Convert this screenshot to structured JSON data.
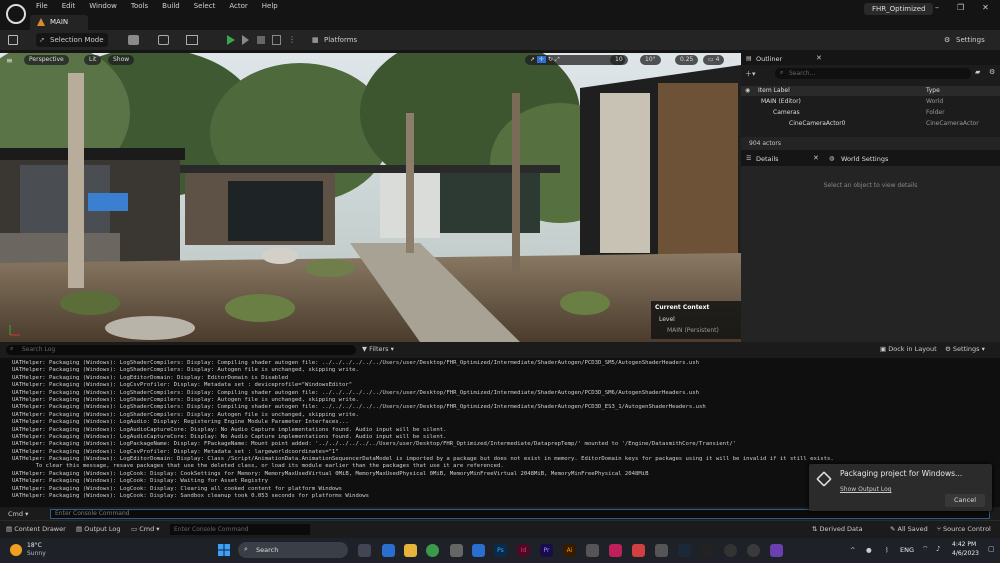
{
  "menu": [
    "File",
    "Edit",
    "Window",
    "Tools",
    "Build",
    "Select",
    "Actor",
    "Help"
  ],
  "level_tab": "MAIN",
  "project_name": "FHR_Optimized",
  "toolbar": {
    "selection_mode": "Selection Mode",
    "platforms": "Platforms",
    "settings": "Settings"
  },
  "viewport": {
    "perspective": "Perspective",
    "lit": "Lit",
    "show": "Show",
    "grid": "10",
    "angle": "10°",
    "scale": "0.25",
    "camera_speed": "4",
    "context_title": "Current Context",
    "context_level": "Level",
    "context_value": "MAIN (Persistent)"
  },
  "outliner": {
    "title": "Outliner",
    "search_placeholder": "Search...",
    "col_label": "Item Label",
    "col_type": "Type",
    "rows": [
      {
        "label": "MAIN (Editor)",
        "type": "World"
      },
      {
        "label": "Cameras",
        "type": "Folder"
      },
      {
        "label": "CineCameraActor0",
        "type": "CineCameraActor"
      }
    ],
    "actor_count": "904 actors"
  },
  "details": {
    "tab1": "Details",
    "tab2": "World Settings",
    "empty_message": "Select an object to view details"
  },
  "output_log": {
    "search_placeholder": "Search Log",
    "filters": "Filters",
    "dock": "Dock in Layout",
    "settings": "Settings",
    "lines": [
      "UATHelper: Packaging (Windows): LogShaderCompilers: Display: Compiling shader autogen file: ../../../../../../Users/user/Desktop/FHR_Optimized/Intermediate/ShaderAutogen/PCD3D_SM5/AutogenShaderHeaders.ush",
      "UATHelper: Packaging (Windows): LogShaderCompilers: Display: Autogen file is unchanged, skipping write.",
      "UATHelper: Packaging (Windows): LogEditorDomain: Display: EditorDomain is Disabled",
      "UATHelper: Packaging (Windows): LogCsvProfiler: Display: Metadata set : deviceprofile=\"WindowsEditor\"",
      "UATHelper: Packaging (Windows): LogShaderCompilers: Display: Compiling shader autogen file: ../../../../../../Users/user/Desktop/FHR_Optimized/Intermediate/ShaderAutogen/PCD3D_SM6/AutogenShaderHeaders.ush",
      "UATHelper: Packaging (Windows): LogShaderCompilers: Display: Autogen file is unchanged, skipping write.",
      "UATHelper: Packaging (Windows): LogShaderCompilers: Display: Compiling shader autogen file: ../../../../../../Users/user/Desktop/FHR_Optimized/Intermediate/ShaderAutogen/PCD3D_ES3_1/AutogenShaderHeaders.ush",
      "UATHelper: Packaging (Windows): LogShaderCompilers: Display: Autogen file is unchanged, skipping write.",
      "UATHelper: Packaging (Windows): LogAudio: Display: Registering Engine Module Parameter Interfaces...",
      "UATHelper: Packaging (Windows): LogAudioCaptureCore: Display: No Audio Capture implementations found. Audio input will be silent.",
      "UATHelper: Packaging (Windows): LogAudioCaptureCore: Display: No Audio Capture implementations found. Audio input will be silent.",
      "UATHelper: Packaging (Windows): LogPackageName: Display: FPackageName: Mount point added: '../../../../../../Users/user/Desktop/FHR_Optimized/Intermediate/DataprepTemp/' mounted to '/Engine/DatasmithCore/Transient/'",
      "UATHelper: Packaging (Windows): LogCsvProfiler: Display: Metadata set : largeworldcoordinates=\"1\"",
      "UATHelper: Packaging (Windows): LogEditorDomain: Display: Class /Script/AnimationData.AnimationSequencerDataModel is imported by a package but does not exist in memory. EditorDomain keys for packages using it will be invalid if it still exists.",
      "       To clear this message, resave packages that use the deleted class, or load its module earlier than the packages that use it are referenced.",
      "UATHelper: Packaging (Windows): LogCook: Display: CookSettings for Memory: MemoryMaxUsedVirtual 0MiB, MemoryMaxUsedPhysical 0MiB, MemoryMinFreeVirtual 2048MiB, MemoryMinFreePhysical 2048MiB",
      "UATHelper: Packaging (Windows): LogCook: Display: Waiting for Asset Registry",
      "UATHelper: Packaging (Windows): LogCook: Display: Clearing all cooked content for platform Windows",
      "UATHelper: Packaging (Windows): LogCook: Display: Sandbox cleanup took 0.053 seconds for platforms Windows"
    ],
    "cmd_label": "Cmd",
    "cmd_placeholder": "Enter Console Command"
  },
  "toast": {
    "title": "Packaging project for Windows...",
    "link": "Show Output Log",
    "cancel": "Cancel"
  },
  "status_bar": {
    "content_drawer": "Content Drawer",
    "output_log": "Output Log",
    "cmd": "Cmd",
    "cmd_placeholder": "Enter Console Command",
    "derived_data": "Derived Data",
    "all_saved": "All Saved",
    "source_control": "Source Control"
  },
  "taskbar": {
    "weather_temp": "18°C",
    "weather_desc": "Sunny",
    "search": "Search",
    "lang": "ENG",
    "time": "4:42 PM",
    "date": "4/6/2023",
    "icons": [
      "Ps",
      "Pr",
      "Ai",
      "Id"
    ]
  },
  "colors": {
    "accent": "#2d6fd4",
    "play_green": "#3aa54a",
    "ue_orange": "#e08a2a"
  }
}
